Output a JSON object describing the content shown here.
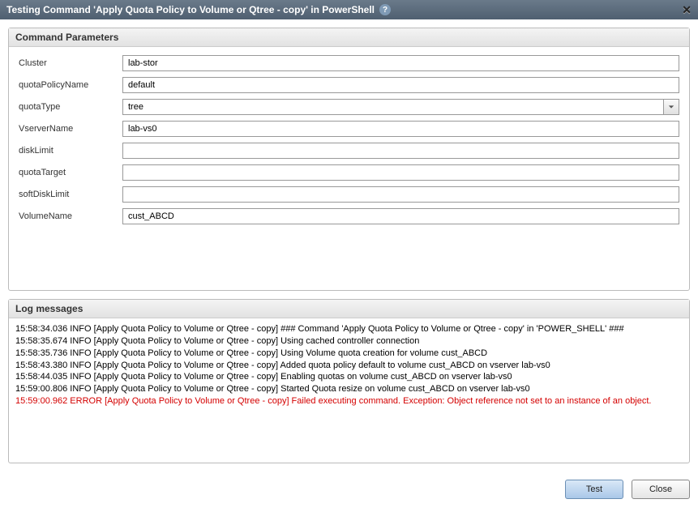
{
  "title": "Testing Command 'Apply Quota Policy to Volume or Qtree - copy' in PowerShell",
  "panels": {
    "params_header": "Command Parameters",
    "log_header": "Log messages"
  },
  "fields": {
    "cluster": {
      "label": "Cluster",
      "value": "lab-stor"
    },
    "quotaPolicyName": {
      "label": "quotaPolicyName",
      "value": "default"
    },
    "quotaType": {
      "label": "quotaType",
      "value": "tree"
    },
    "vserverName": {
      "label": "VserverName",
      "value": "lab-vs0"
    },
    "diskLimit": {
      "label": "diskLimit",
      "value": ""
    },
    "quotaTarget": {
      "label": "quotaTarget",
      "value": ""
    },
    "softDiskLimit": {
      "label": "softDiskLimit",
      "value": ""
    },
    "volumeName": {
      "label": "VolumeName",
      "value": "cust_ABCD"
    }
  },
  "log": [
    {
      "level": "INFO",
      "text": "15:58:34.036 INFO  [Apply Quota Policy to Volume or Qtree - copy] ### Command 'Apply Quota Policy to Volume or Qtree - copy' in 'POWER_SHELL' ###"
    },
    {
      "level": "INFO",
      "text": "15:58:35.674 INFO  [Apply Quota Policy to Volume or Qtree - copy] Using cached controller connection"
    },
    {
      "level": "INFO",
      "text": "15:58:35.736 INFO  [Apply Quota Policy to Volume or Qtree - copy] Using Volume quota creation for volume cust_ABCD"
    },
    {
      "level": "INFO",
      "text": "15:58:43.380 INFO  [Apply Quota Policy to Volume or Qtree - copy] Added quota policy default to volume cust_ABCD on vserver lab-vs0"
    },
    {
      "level": "INFO",
      "text": "15:58:44.035 INFO  [Apply Quota Policy to Volume or Qtree - copy] Enabling quotas on volume cust_ABCD on vserver lab-vs0"
    },
    {
      "level": "INFO",
      "text": "15:59:00.806 INFO  [Apply Quota Policy to Volume or Qtree - copy] Started Quota resize on volume cust_ABCD on vserver lab-vs0"
    },
    {
      "level": "ERROR",
      "text": "15:59:00.962 ERROR  [Apply Quota Policy to Volume or Qtree - copy] Failed executing command. Exception: Object reference not set to an instance of an object."
    }
  ],
  "buttons": {
    "test": "Test",
    "close": "Close"
  }
}
